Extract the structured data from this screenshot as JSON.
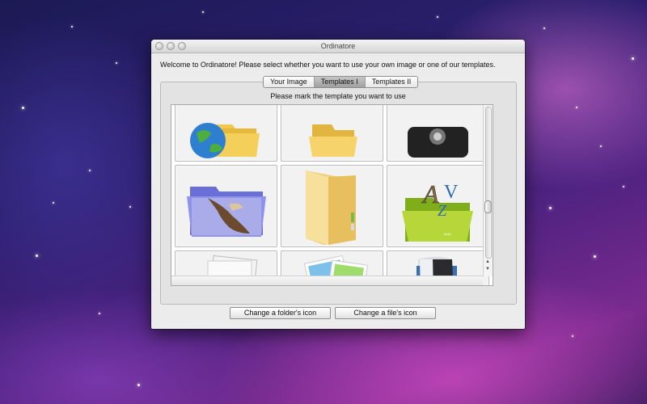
{
  "window": {
    "title": "Ordinatore"
  },
  "intro_text": "Welcome to Ordinatore! Please select whether you want to use your own image or one of our templates.",
  "tabs": [
    {
      "label": "Your Image",
      "active": false
    },
    {
      "label": "Templates I",
      "active": true
    },
    {
      "label": "Templates II",
      "active": false
    }
  ],
  "prompt": "Please mark the template you want to use",
  "templates": [
    {
      "name": "globe-folder-icon"
    },
    {
      "name": "plain-folder-icon"
    },
    {
      "name": "dark-disc-icon"
    },
    {
      "name": "bird-folder-icon"
    },
    {
      "name": "manila-folder-icon"
    },
    {
      "name": "fonts-folder-icon"
    },
    {
      "name": "orange-documents-folder-icon"
    },
    {
      "name": "photos-folder-icon"
    },
    {
      "name": "silver-folder-icon"
    }
  ],
  "buttons": {
    "folder": "Change a folder's icon",
    "file": "Change a file's icon"
  },
  "font_icon_text": {
    "a": "A",
    "z": "Z",
    "v": "V",
    "label": "fonts"
  }
}
